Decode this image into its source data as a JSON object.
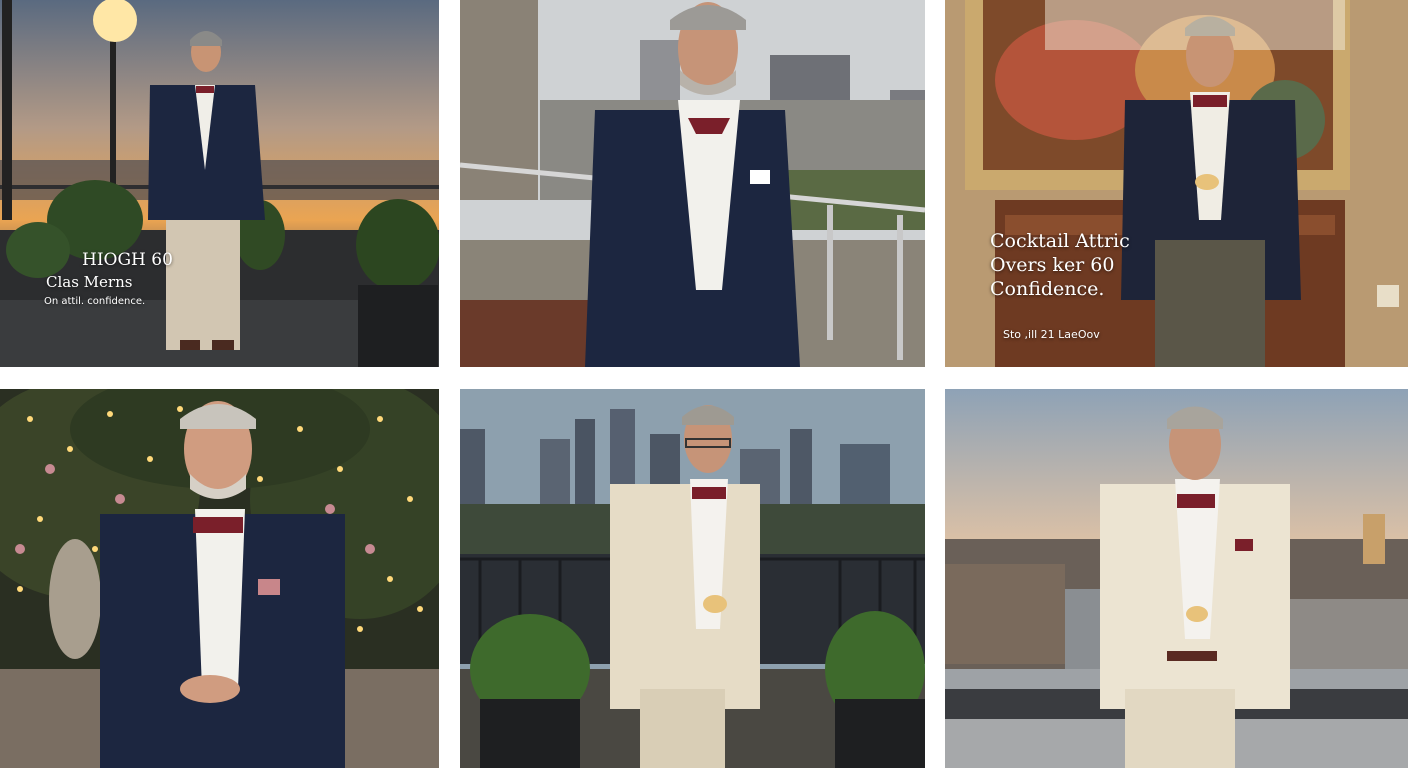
{
  "panels": [
    {
      "id": "panel-1",
      "description": "man in navy blazer and bow tie on rooftop at sunset",
      "overlay": {
        "line1": "HIOGH 60",
        "line2": "Clas Merns",
        "line3": "On attil. confidence."
      }
    },
    {
      "id": "panel-2",
      "description": "man in navy suit with red bow tie on city rooftop"
    },
    {
      "id": "panel-3",
      "description": "man in plaid blazer holding cocktail in lounge",
      "overlay": {
        "title": "Cocktail Attric Overs ker 60 Confidence.",
        "footer": "Sto ,ill 21 LaeOov"
      }
    },
    {
      "id": "panel-4",
      "description": "man in navy blazer with patterned bow tie in evening garden with string lights"
    },
    {
      "id": "panel-5",
      "description": "man in cream suit with glasses holding drink on skyline terrace"
    },
    {
      "id": "panel-6",
      "description": "man in cream suit holding drink on rooftop at dusk"
    }
  ],
  "colors": {
    "navy": "#1c2640",
    "cream": "#e6dcc6",
    "burgundy": "#7a1f2a",
    "sunset": "#e9a04c"
  }
}
